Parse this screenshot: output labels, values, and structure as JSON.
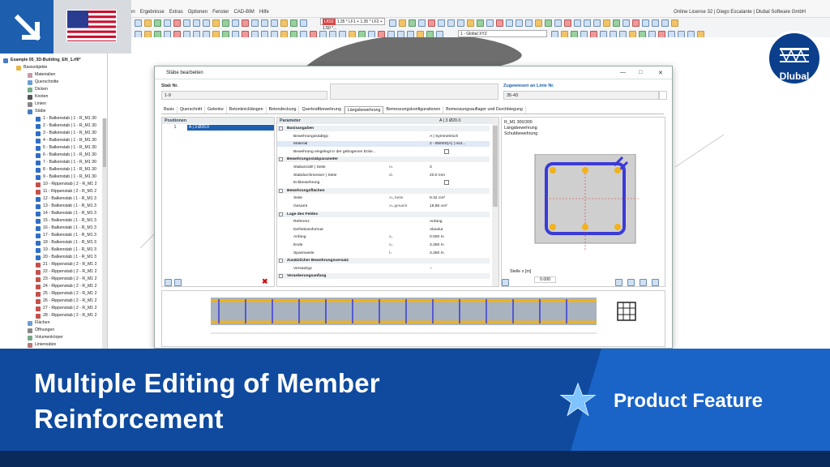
{
  "app": {
    "menu": [
      "en",
      "Ergebnisse",
      "Extras",
      "Optionen",
      "Fenster",
      "CAD-BIM",
      "Hilfe"
    ],
    "license": "Online License 32 | Diego Escalante | Dlubal Software GmbH",
    "load_combo": {
      "tag": "LK52",
      "text": "1.35 * LF1 + 1.35 * LF2 + 1.50 *..."
    },
    "view_combo": "1 - Global XYZ",
    "file_title": "...1.rf6"
  },
  "navigator": {
    "root": "Example 05_3D-Building_EN_1.rf6*",
    "basis": "Basisobjekte",
    "groups": [
      "Materialien",
      "Querschnitte",
      "Dicken",
      "Knoten",
      "Linien",
      "Stäbe"
    ],
    "members": [
      "1 - Balkenstab | 1 - R_M1 30",
      "2 - Balkenstab | 1 - R_M1 30",
      "3 - Balkenstab | 1 - R_M1 30",
      "4 - Balkenstab | 1 - R_M1 30",
      "5 - Balkenstab | 1 - R_M1 30",
      "6 - Balkenstab | 1 - R_M1 30",
      "7 - Balkenstab | 1 - R_M1 30",
      "8 - Balkenstab | 1 - R_M1 30",
      "9 - Balkenstab | 1 - R_M1 30",
      "10 - Rippenstab | 2 - R_M1 2",
      "11 - Rippenstab | 2 - R_M1 2",
      "12 - Balkenstab | 1 - R_M1 3",
      "13 - Balkenstab | 1 - R_M1 3",
      "14 - Balkenstab | 1 - R_M1 3",
      "15 - Balkenstab | 1 - R_M1 3",
      "16 - Balkenstab | 1 - R_M1 3",
      "17 - Balkenstab | 1 - R_M1 3",
      "18 - Balkenstab | 1 - R_M1 3",
      "19 - Balkenstab | 1 - R_M1 3",
      "20 - Balkenstab | 1 - R_M1 3",
      "21 - Rippenstab | 2 - R_M1 2",
      "22 - Rippenstab | 2 - R_M1 2",
      "23 - Rippenstab | 2 - R_M1 2",
      "24 - Rippenstab | 2 - R_M1 2",
      "25 - Rippenstab | 2 - R_M1 2",
      "26 - Rippenstab | 2 - R_M1 2",
      "27 - Rippenstab | 2 - R_M1 2",
      "28 - Rippenstab | 2 - R_M1 2"
    ],
    "after": [
      "Flächen",
      "Öffnungen",
      "Volumenkörper",
      "Liniensätze"
    ]
  },
  "dialog": {
    "title": "Stäbe bearbeiten",
    "stab_nr_label": "Stab Nr.",
    "stab_nr_value": "1-9",
    "assigned_label": "Zugewiesen an Linie Nr.",
    "assigned_value": "35-43",
    "tabs": [
      "Basis",
      "Querschnitt",
      "Gelenke",
      "Betonknicklängen",
      "Betondeckung",
      "Querkraftbewehrung",
      "Längsbewehrung",
      "Bemessungskonfigurationen",
      "Bemessungsauflager und Durchbiegung"
    ],
    "active_tab": 6,
    "positions_header": "Positionen",
    "positions_row_no": "1",
    "positions_row_val": "A | 3 Ø20.0",
    "params_header": "Parameter",
    "params_header_right": "A | 3 Ø20.0",
    "xsec_header": "R_M1 300/300",
    "xsec_line2": "Längsbewehrung",
    "xsec_line3": "Schubbewehrung",
    "stelle_label": "Stelle x [m]",
    "stelle_value": "0.000",
    "params": [
      {
        "t": "sec",
        "n": "Basisangaben"
      },
      {
        "t": "ind",
        "n": "Bewehrungsstabtyp",
        "v": "A | Symmetrisch"
      },
      {
        "t": "ind sel",
        "n": "Material",
        "v": "2 - B500S(A) | Isot..."
      },
      {
        "t": "ind",
        "n": "Bewehrung eingelegt in der gebogenen Ecke...",
        "chk": true
      },
      {
        "t": "sec",
        "n": "Bewehrungsstabparameter"
      },
      {
        "t": "ind",
        "n": "Stabanzahl | Seite",
        "s": "nₛ",
        "v": "3"
      },
      {
        "t": "ind",
        "n": "Stabdurchmesser | Seite",
        "s": "dₛ",
        "v": "20.0   mm"
      },
      {
        "t": "ind",
        "n": "Eckbewehrung",
        "chk": true
      },
      {
        "t": "sec",
        "n": "Bewehrungsflächen"
      },
      {
        "t": "ind",
        "n": "Seite",
        "s": "Aₛ,Seite",
        "v": "9.42   cm²"
      },
      {
        "t": "ind",
        "n": "Gesamt",
        "s": "Aₛ,gesamt",
        "v": "18.85   cm²"
      },
      {
        "t": "sec",
        "n": "Lage des Feldes"
      },
      {
        "t": "ind",
        "n": "Referenz",
        "v": "Anfang"
      },
      {
        "t": "ind",
        "n": "Definitionsformat",
        "v": "Absolut"
      },
      {
        "t": "ind",
        "n": "Anfang",
        "s": "x₁",
        "v": "0.000   m"
      },
      {
        "t": "ind",
        "n": "Ende",
        "s": "x₂",
        "v": "3.250   m"
      },
      {
        "t": "ind",
        "n": "Spannweite",
        "s": "lₛ",
        "v": "3.250   m"
      },
      {
        "t": "sec",
        "n": "Zusätzlicher Bewehrungsversatz"
      },
      {
        "t": "ind",
        "n": "Versatztyp",
        "v": "--"
      },
      {
        "t": "sec",
        "n": "Verankerungsanfang"
      }
    ]
  },
  "banner": {
    "title_line1": "Multiple Editing of Member",
    "title_line2": "Reinforcement",
    "feature": "Product Feature",
    "logo": "Dlubal"
  },
  "colors": {
    "brand_blue": "#0f4a9e",
    "accent_blue": "#1a64c8",
    "rebar_yellow": "#f2b21b",
    "stirrup_blue": "#3b3bd6"
  }
}
